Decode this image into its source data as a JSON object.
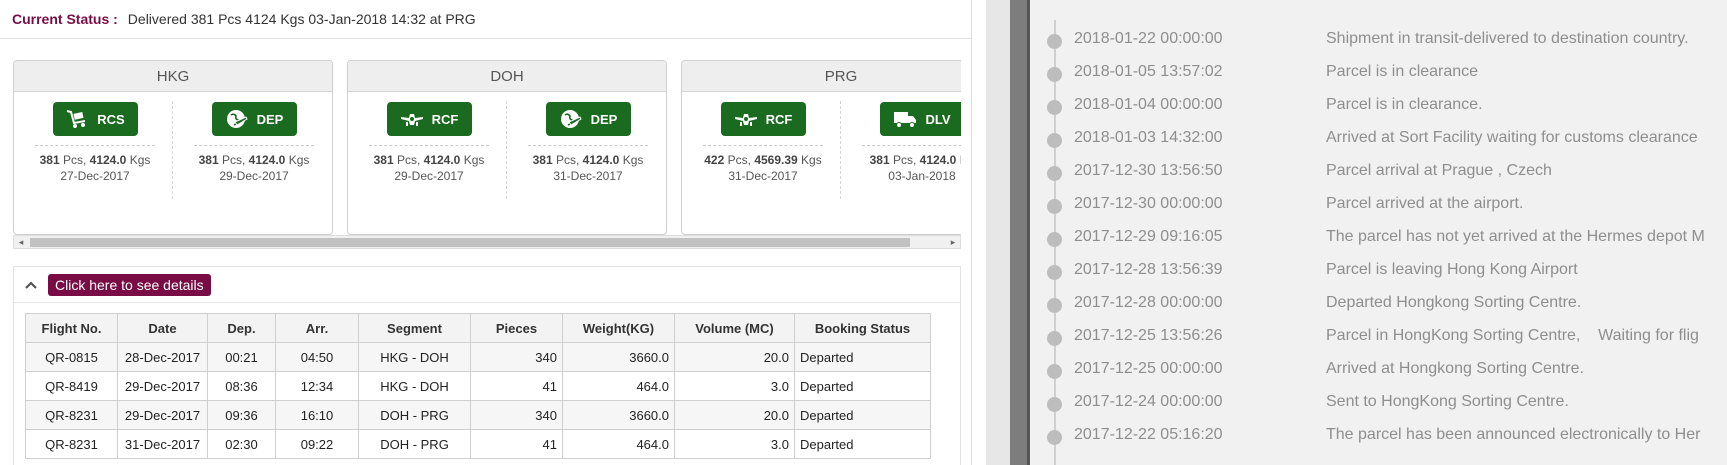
{
  "status": {
    "label": "Current Status :",
    "text": "Delivered 381 Pcs 4124 Kgs 03-Jan-2018 14:32 at PRG"
  },
  "stations": [
    {
      "name": "HKG",
      "events": [
        {
          "code": "RCS",
          "icon": "cart-icon",
          "pieces": "381",
          "pcs_label": "Pcs,",
          "weight": "4124.0",
          "kgs_label": "Kgs",
          "date": "27-Dec-2017"
        },
        {
          "code": "DEP",
          "icon": "globe-plane-icon",
          "pieces": "381",
          "pcs_label": "Pcs,",
          "weight": "4124.0",
          "kgs_label": "Kgs",
          "date": "29-Dec-2017"
        }
      ]
    },
    {
      "name": "DOH",
      "events": [
        {
          "code": "RCF",
          "icon": "plane-front-icon",
          "pieces": "381",
          "pcs_label": "Pcs,",
          "weight": "4124.0",
          "kgs_label": "Kgs",
          "date": "29-Dec-2017"
        },
        {
          "code": "DEP",
          "icon": "globe-plane-icon",
          "pieces": "381",
          "pcs_label": "Pcs,",
          "weight": "4124.0",
          "kgs_label": "Kgs",
          "date": "31-Dec-2017"
        }
      ]
    },
    {
      "name": "PRG",
      "events": [
        {
          "code": "RCF",
          "icon": "plane-front-icon",
          "pieces": "422",
          "pcs_label": "Pcs,",
          "weight": "4569.39",
          "kgs_label": "Kgs",
          "date": "31-Dec-2017"
        },
        {
          "code": "DLV",
          "icon": "truck-icon",
          "pieces": "381",
          "pcs_label": "Pcs,",
          "weight": "4124.0",
          "kgs_label": "Kg",
          "date": "03-Jan-2018"
        }
      ]
    }
  ],
  "details": {
    "button_label": "Click here to see details",
    "columns": [
      "Flight No.",
      "Date",
      "Dep.",
      "Arr.",
      "Segment",
      "Pieces",
      "Weight(KG)",
      "Volume (MC)",
      "Booking Status"
    ],
    "rows": [
      [
        "QR-0815",
        "28-Dec-2017",
        "00:21",
        "04:50",
        "HKG - DOH",
        "340",
        "3660.0",
        "20.0",
        "Departed"
      ],
      [
        "QR-8419",
        "29-Dec-2017",
        "08:36",
        "12:34",
        "HKG - DOH",
        "41",
        "464.0",
        "3.0",
        "Departed"
      ],
      [
        "QR-8231",
        "29-Dec-2017",
        "09:36",
        "16:10",
        "DOH - PRG",
        "340",
        "3660.0",
        "20.0",
        "Departed"
      ],
      [
        "QR-8231",
        "31-Dec-2017",
        "02:30",
        "09:22",
        "DOH - PRG",
        "41",
        "464.0",
        "3.0",
        "Departed"
      ]
    ]
  },
  "timeline": [
    {
      "time": "2018-01-22 00:00:00",
      "message": "Shipment in transit-delivered to destination country."
    },
    {
      "time": "2018-01-05 13:57:02",
      "message": "Parcel is in clearance"
    },
    {
      "time": "2018-01-04 00:00:00",
      "message": "Parcel is in clearance."
    },
    {
      "time": "2018-01-03 14:32:00",
      "message": "Arrived at Sort Facility waiting for customs clearance"
    },
    {
      "time": "2017-12-30 13:56:50",
      "message": "Parcel arrival at Prague , Czech"
    },
    {
      "time": "2017-12-30 00:00:00",
      "message": "Parcel arrived at the airport."
    },
    {
      "time": "2017-12-29 09:16:05",
      "message": "The parcel has not yet arrived at the Hermes depot M"
    },
    {
      "time": "2017-12-28 13:56:39",
      "message": "Parcel is leaving Hong Kong Airport"
    },
    {
      "time": "2017-12-28 00:00:00",
      "message": "Departed Hongkong Sorting Centre."
    },
    {
      "time": "2017-12-25 13:56:26",
      "message": "Parcel in HongKong Sorting Centre,    Waiting for flig"
    },
    {
      "time": "2017-12-25 00:00:00",
      "message": "Arrived at Hongkong Sorting Centre."
    },
    {
      "time": "2017-12-24 00:00:00",
      "message": "Sent to HongKong Sorting Centre."
    },
    {
      "time": "2017-12-22 05:16:20",
      "message": "The parcel has been announced electronically to Her"
    }
  ],
  "colors": {
    "brand": "#7a0c45",
    "event_button": "#1a6a1f"
  }
}
